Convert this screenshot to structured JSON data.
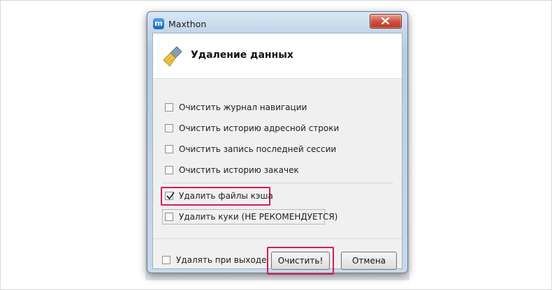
{
  "window": {
    "title": "Maxthon",
    "app_icon_glyph": "m"
  },
  "dialog": {
    "heading": "Удаление данных",
    "options": [
      {
        "label": "Очистить журнал навигации",
        "checked": false
      },
      {
        "label": "Очистить историю адресной строки",
        "checked": false
      },
      {
        "label": "Очистить запись последней сессии",
        "checked": false
      },
      {
        "label": "Очистить историю закачек",
        "checked": false
      },
      {
        "label": "Удалить файлы кэша",
        "checked": true
      },
      {
        "label": "Удалить куки (НЕ РЕКОМЕНДУЕТСЯ)",
        "checked": false
      }
    ],
    "on_exit": {
      "label": "Удалять при выходе",
      "checked": false
    },
    "buttons": {
      "clear": "Очистить!",
      "cancel": "Отмена"
    }
  },
  "colors": {
    "highlight": "#d8185a",
    "close_button": "#c9452f"
  },
  "icons": [
    "maxthon-logo-icon",
    "close-icon",
    "broom-icon",
    "checkmark-icon"
  ]
}
